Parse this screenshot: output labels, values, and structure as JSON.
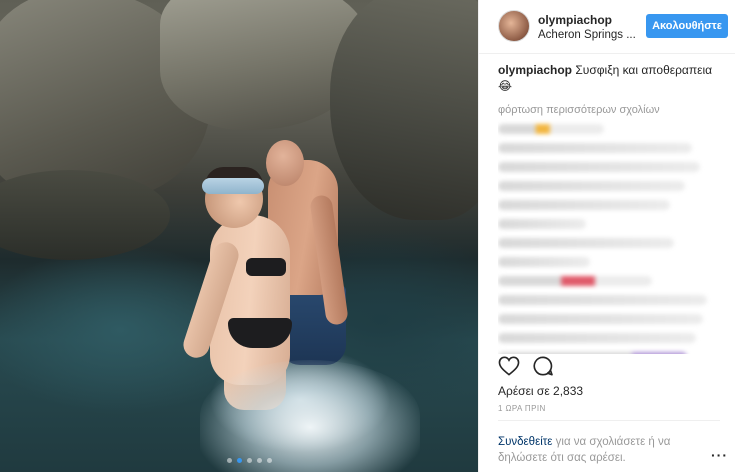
{
  "post": {
    "image_alt": "Couple in a river at Acheron Springs",
    "carousel_dots": 5,
    "active_dot": 1
  },
  "header": {
    "username": "olympiachop",
    "location": "Acheron Springs ...",
    "follow_label": "Ακολουθήστε"
  },
  "caption": {
    "username": "olympiachop",
    "text": "Συσφιξη και αποθεραπεια😂"
  },
  "comments": {
    "load_more_label": "φόρτωση περισσότερων σχολίων"
  },
  "actions": {
    "like_icon": "heart-outline-icon",
    "comment_icon": "speech-bubble-icon"
  },
  "likes_label": "Αρέσει σε 2,833",
  "timestamp": "1 ΩΡΑ ΠΡΙΝ",
  "login_prompt": {
    "link_text": "Συνδεθείτε",
    "rest_text": " για να σχολιάσετε ή να δηλώσετε ότι σας αρέσει."
  },
  "more_label": "···",
  "colors": {
    "accent": "#3897f0",
    "text": "#262626",
    "muted": "#999999",
    "link": "#003569"
  }
}
